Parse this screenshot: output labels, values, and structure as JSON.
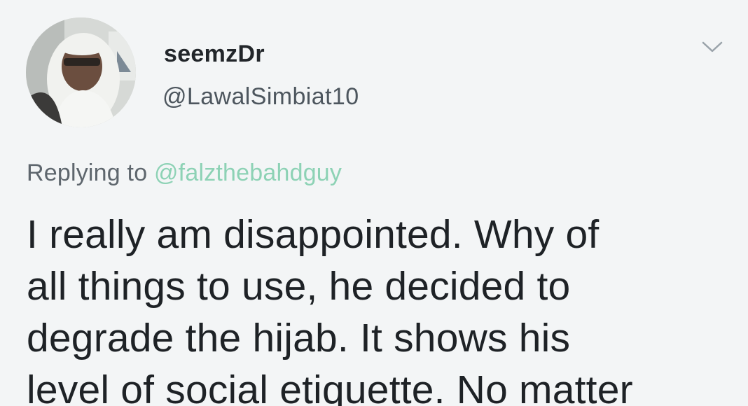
{
  "tweet": {
    "display_name": "seemzDr",
    "handle": "@LawalSimbiat10",
    "replying_prefix": "Replying to",
    "reply_mention": "@falzthebahdguy",
    "text_lines": [
      "I really am disappointed. Why of",
      "all things to use, he decided to",
      "degrade the hijab. It shows his",
      "level of social etiquette. No matter"
    ],
    "avatar_icon": "profile-photo",
    "menu_icon": "chevron-down-icon",
    "mention_color": "#8dd2b5"
  }
}
